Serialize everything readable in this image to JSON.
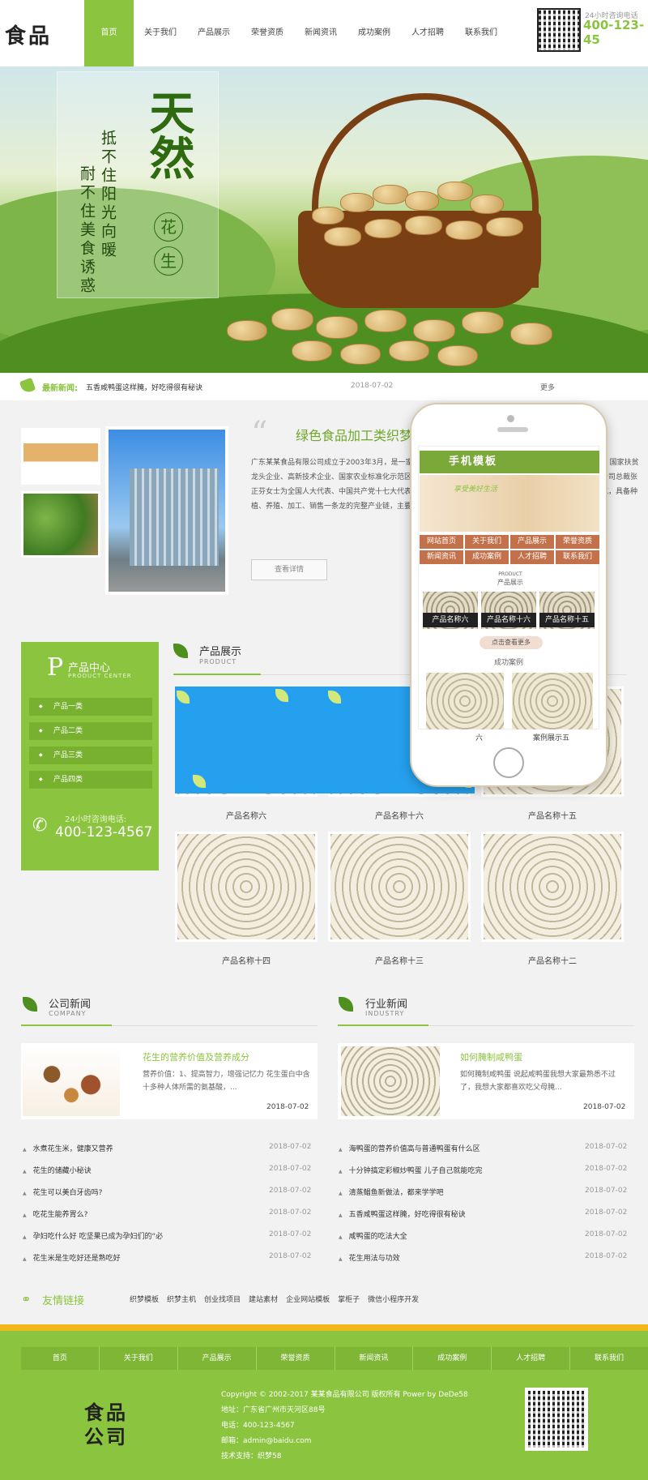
{
  "brand": {
    "logo": "食品"
  },
  "nav": [
    "首页",
    "关于我们",
    "产品展示",
    "荣誉资质",
    "新闻资讯",
    "成功案例",
    "人才招聘",
    "联系我们"
  ],
  "header_contact": {
    "label": "24小时咨询电话",
    "phone": "400-123-45"
  },
  "banner": {
    "title": "天然",
    "circle1": "花",
    "circle2": "生",
    "line1": "抵不住阳光向暖",
    "line2": "耐不住美食诱惑"
  },
  "newsbar": {
    "label": "最新新闻:",
    "text": "五香咸鸭蛋这样腌，好吃得很有秘诀",
    "date": "2018-07-02",
    "more": "更多"
  },
  "about": {
    "title": "绿色食品加工类织梦",
    "text": "广东某某食品有限公司成立于2003年3月，是一家集种植、加工、销售于一体的农业产业化国家重点龙头企业、国家扶贫龙头企业、高新技术企业、国家农业标准化示范区、全国主食加工业示范企业、国家肉鸡良种扩繁推广基地。公司总裁张正芬女士为全国人大代表、中国共产党十七大代表、全国三八红旗手、中国扶贫开发典型人物、广东省劳动模范，具备种植、养殖、加工、销售一条龙的完整产业链，主要从事种植、种苗繁育、饲...",
    "button": "查看详情"
  },
  "phone_mockup": {
    "header": "手机模板",
    "banner_text": "享受美好生活",
    "nav": [
      "网站首页",
      "关于我们",
      "产品展示",
      "荣誉资质",
      "新闻资讯",
      "成功案例",
      "人才招聘",
      "联系我们"
    ],
    "section_en": "PRODUCT",
    "section_cn": "产品展示",
    "products": [
      "产品名称六",
      "产品名称十六",
      "产品名称十五"
    ],
    "more": "点击查看更多",
    "cases_title": "成功案例",
    "case_captions": [
      "六",
      "案例展示五"
    ]
  },
  "sidebar": {
    "letter": "P",
    "title": "产品中心",
    "subtitle": "PRODUCT CENTER",
    "items": [
      "产品一类",
      "产品二类",
      "产品三类",
      "产品四类"
    ],
    "tel_label": "24小时咨询电话:",
    "tel": "400-123-4567"
  },
  "products": {
    "title": "产品展示",
    "subtitle": "PRODUCT",
    "items": [
      "产品名称六",
      "产品名称十六",
      "产品名称十五",
      "产品名称十四",
      "产品名称十三",
      "产品名称十二"
    ]
  },
  "company_news": {
    "title": "公司新闻",
    "subtitle": "COMPANY",
    "featured": {
      "title": "花生的营养价值及营养成分",
      "text": "营养价值：1、提高智力，增强记忆力 花生蛋白中含十多种人体所需的氨基酸，...",
      "date": "2018-07-02"
    },
    "list": [
      {
        "title": "水煮花生米，健康又营养",
        "date": "2018-07-02"
      },
      {
        "title": "花生的储藏小秘诀",
        "date": "2018-07-02"
      },
      {
        "title": "花生可以美白牙齿吗?",
        "date": "2018-07-02"
      },
      {
        "title": "吃花生能养胃么?",
        "date": "2018-07-02"
      },
      {
        "title": "孕妇吃什么好 吃坚果已成为孕妇们的“必",
        "date": "2018-07-02"
      },
      {
        "title": "花生米是生吃好还是熟吃好",
        "date": "2018-07-02"
      }
    ]
  },
  "industry_news": {
    "title": "行业新闻",
    "subtitle": "INDUSTRY",
    "featured": {
      "title": "如何腌制咸鸭蛋",
      "text": "如何腌制咸鸭蛋 说起咸鸭蛋我想大家最熟悉不过了，我想大家都喜欢吃父母腌...",
      "date": "2018-07-02"
    },
    "list": [
      {
        "title": "海鸭蛋的营养价值高与普通鸭蛋有什么区",
        "date": "2018-07-02"
      },
      {
        "title": "十分钟搞定彩椒炒鸭蛋 儿子自己就能吃完",
        "date": "2018-07-02"
      },
      {
        "title": "清蒸鲳鱼新做法，都来学学吧",
        "date": "2018-07-02"
      },
      {
        "title": "五香咸鸭蛋这样腌，好吃得很有秘诀",
        "date": "2018-07-02"
      },
      {
        "title": "咸鸭蛋的吃法大全",
        "date": "2018-07-02"
      },
      {
        "title": "花生用法与功效",
        "date": "2018-07-02"
      }
    ]
  },
  "links": {
    "title": "友情链接",
    "items": [
      "织梦模板",
      "织梦主机",
      "创业找项目",
      "建站素材",
      "企业网站模板",
      "掌柜子",
      "微信小程序开发"
    ]
  },
  "footer": {
    "nav": [
      "首页",
      "关于我们",
      "产品展示",
      "荣誉资质",
      "新闻资讯",
      "成功案例",
      "人才招聘",
      "联系我们"
    ],
    "logo1": "食品",
    "logo2": "公司",
    "copyright": "Copyright © 2002-2017 某某食品有限公司 版权所有 Power by DeDe58",
    "address": "地址：广东省广州市天河区88号",
    "phone": "电话：400-123-4567",
    "email": "邮箱：admin@baidu.com",
    "support": "技术支持：织梦58"
  },
  "colors": {
    "accent": "#8bc43f",
    "dark_accent": "#4e8f1f",
    "band": "#f2b81a"
  }
}
